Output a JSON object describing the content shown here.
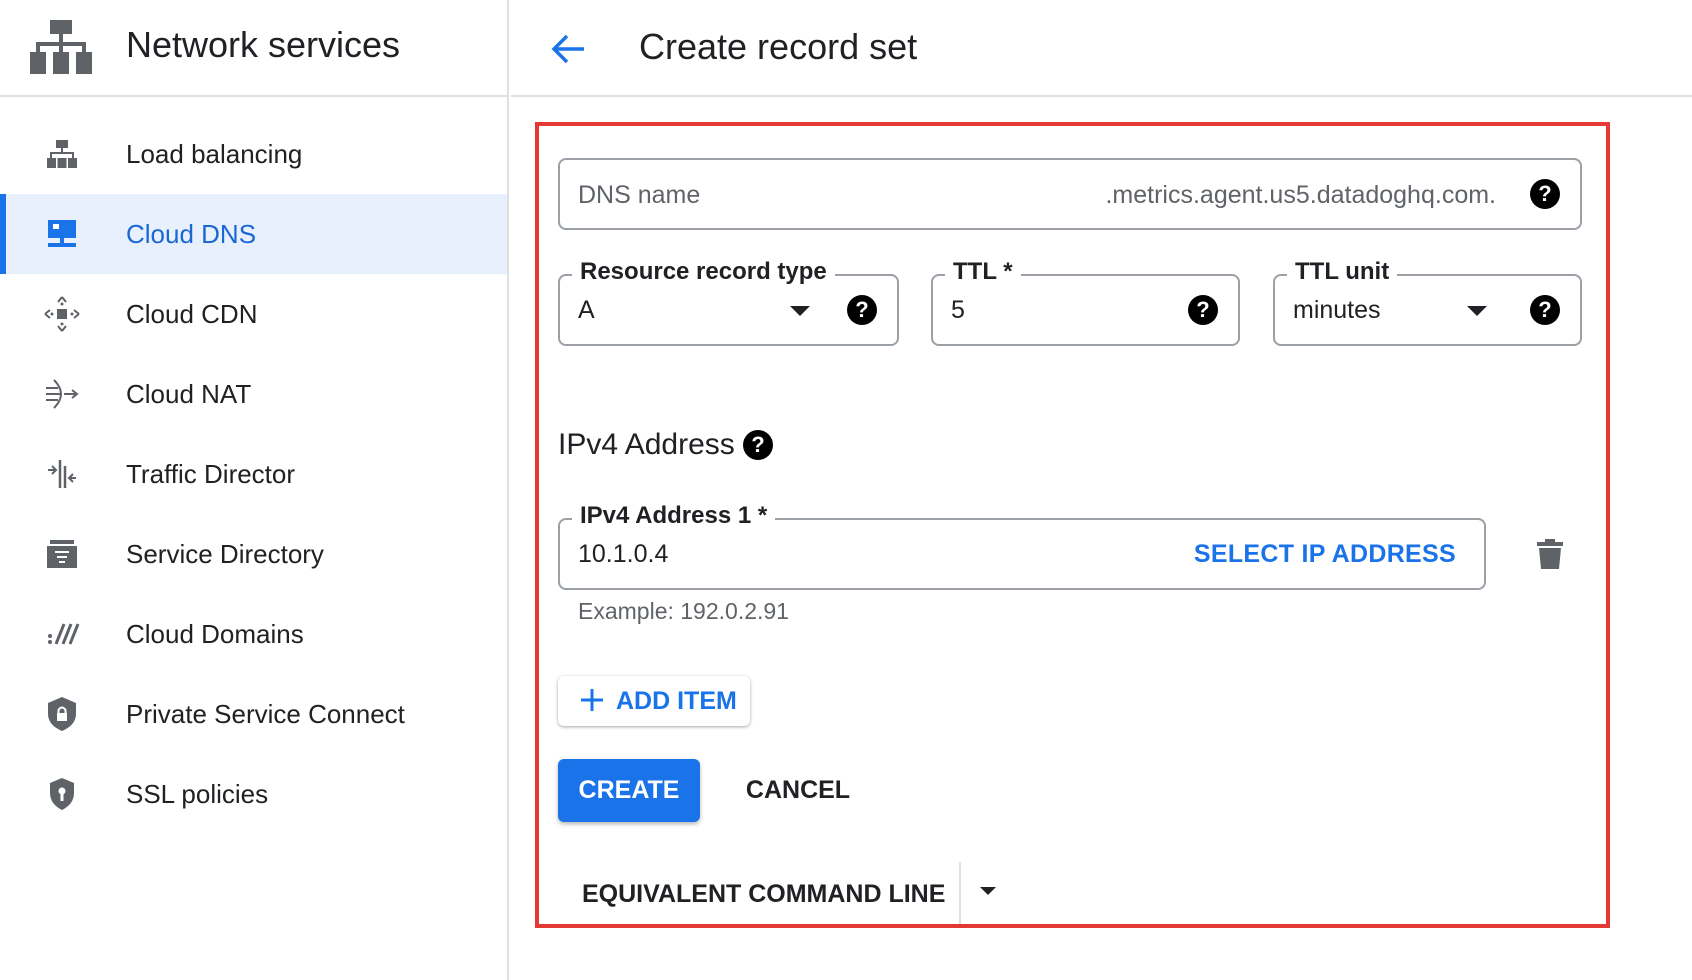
{
  "sidebar": {
    "title": "Network services",
    "items": [
      {
        "label": "Load balancing",
        "icon": "load-balancing-icon",
        "active": false
      },
      {
        "label": "Cloud DNS",
        "icon": "cloud-dns-icon",
        "active": true
      },
      {
        "label": "Cloud CDN",
        "icon": "cloud-cdn-icon",
        "active": false
      },
      {
        "label": "Cloud NAT",
        "icon": "cloud-nat-icon",
        "active": false
      },
      {
        "label": "Traffic Director",
        "icon": "traffic-director-icon",
        "active": false
      },
      {
        "label": "Service Directory",
        "icon": "service-directory-icon",
        "active": false
      },
      {
        "label": "Cloud Domains",
        "icon": "cloud-domains-icon",
        "active": false
      },
      {
        "label": "Private Service Connect",
        "icon": "private-service-connect-icon",
        "active": false
      },
      {
        "label": "SSL policies",
        "icon": "ssl-policies-icon",
        "active": false
      }
    ]
  },
  "header": {
    "title": "Create record set"
  },
  "form": {
    "dns_name": {
      "placeholder": "DNS name",
      "suffix": ".metrics.agent.us5.datadoghq.com."
    },
    "record_type": {
      "label": "Resource record type",
      "value": "A"
    },
    "ttl": {
      "label": "TTL *",
      "value": "5"
    },
    "ttl_unit": {
      "label": "TTL unit",
      "value": "minutes"
    },
    "ipv4_section_title": "IPv4 Address",
    "ipv4_address": {
      "label": "IPv4 Address 1 *",
      "value": "10.1.0.4",
      "select_label": "SELECT IP ADDRESS",
      "hint": "Example: 192.0.2.91"
    },
    "add_item_label": "ADD ITEM",
    "create_label": "CREATE",
    "cancel_label": "CANCEL",
    "command_line_label": "EQUIVALENT COMMAND LINE"
  },
  "colors": {
    "accent": "#1a73e8",
    "active_bg": "#e8f0fe",
    "highlight_border": "#e53935",
    "icon_gray": "#5f6368"
  }
}
